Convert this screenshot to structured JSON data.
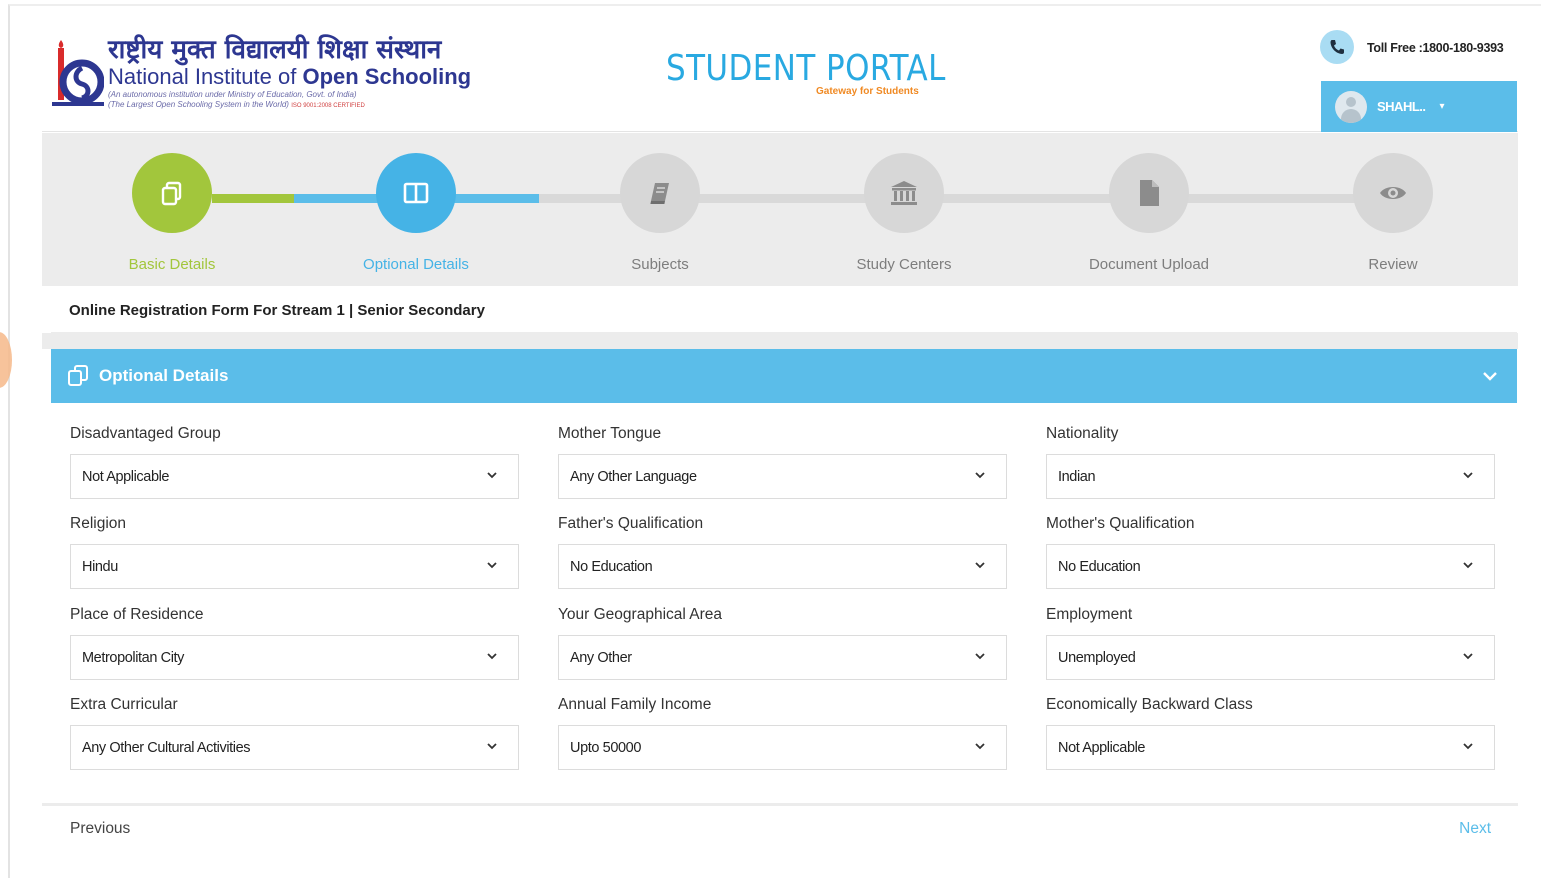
{
  "header": {
    "hindi_name": "राष्ट्रीय मुक्त विद्यालयी शिक्षा संस्थान",
    "english_name_prefix": "National Institute of ",
    "english_name_bold": "Open Schooling",
    "subtitle_1": "(An autonomous institution under Ministry of Education, Govt. of India)",
    "subtitle_2": "(The Largest Open Schooling System in the World)",
    "iso": "ISO 9001:2008 CERTIFIED",
    "portal_title": "STUDENT PORTAL",
    "portal_tagline": "Gateway for Students",
    "toll_free": "Toll Free :1800-180-9393",
    "user_name": "SHAHL..",
    "user_caret": "▾"
  },
  "stepper": {
    "steps": [
      {
        "label": "Basic Details",
        "icon": "copy-icon",
        "state": "done"
      },
      {
        "label": "Optional Details",
        "icon": "columns-icon",
        "state": "active"
      },
      {
        "label": "Subjects",
        "icon": "book-icon",
        "state": "pending"
      },
      {
        "label": "Study Centers",
        "icon": "institution-icon",
        "state": "pending"
      },
      {
        "label": "Document Upload",
        "icon": "file-icon",
        "state": "pending"
      },
      {
        "label": "Review",
        "icon": "eye-icon",
        "state": "pending"
      }
    ]
  },
  "form": {
    "title": "Online Registration Form For Stream 1 | Senior Secondary",
    "panel_title": "Optional Details",
    "fields": [
      {
        "label": "Disadvantaged Group",
        "value": "Not Applicable"
      },
      {
        "label": "Mother Tongue",
        "value": "Any Other Language"
      },
      {
        "label": "Nationality",
        "value": "Indian"
      },
      {
        "label": "Religion",
        "value": "Hindu"
      },
      {
        "label": "Father's Qualification",
        "value": "No Education"
      },
      {
        "label": "Mother's Qualification",
        "value": "No Education"
      },
      {
        "label": "Place of Residence",
        "value": "Metropolitan City"
      },
      {
        "label": "Your Geographical Area",
        "value": "Any Other"
      },
      {
        "label": "Employment",
        "value": "Unemployed"
      },
      {
        "label": "Extra Curricular",
        "value": "Any Other Cultural Activities"
      },
      {
        "label": "Annual Family Income",
        "value": "Upto 50000"
      },
      {
        "label": "Economically Backward Class",
        "value": "Not Applicable"
      }
    ]
  },
  "footer": {
    "previous_label": "Previous",
    "next_label": "Next"
  },
  "colors": {
    "accent_blue": "#5bbde9",
    "done_green": "#a2c63c",
    "pending_gray": "#d7d7d7",
    "portal_blue": "#29a9e1",
    "brand_navy": "#2d3791"
  }
}
